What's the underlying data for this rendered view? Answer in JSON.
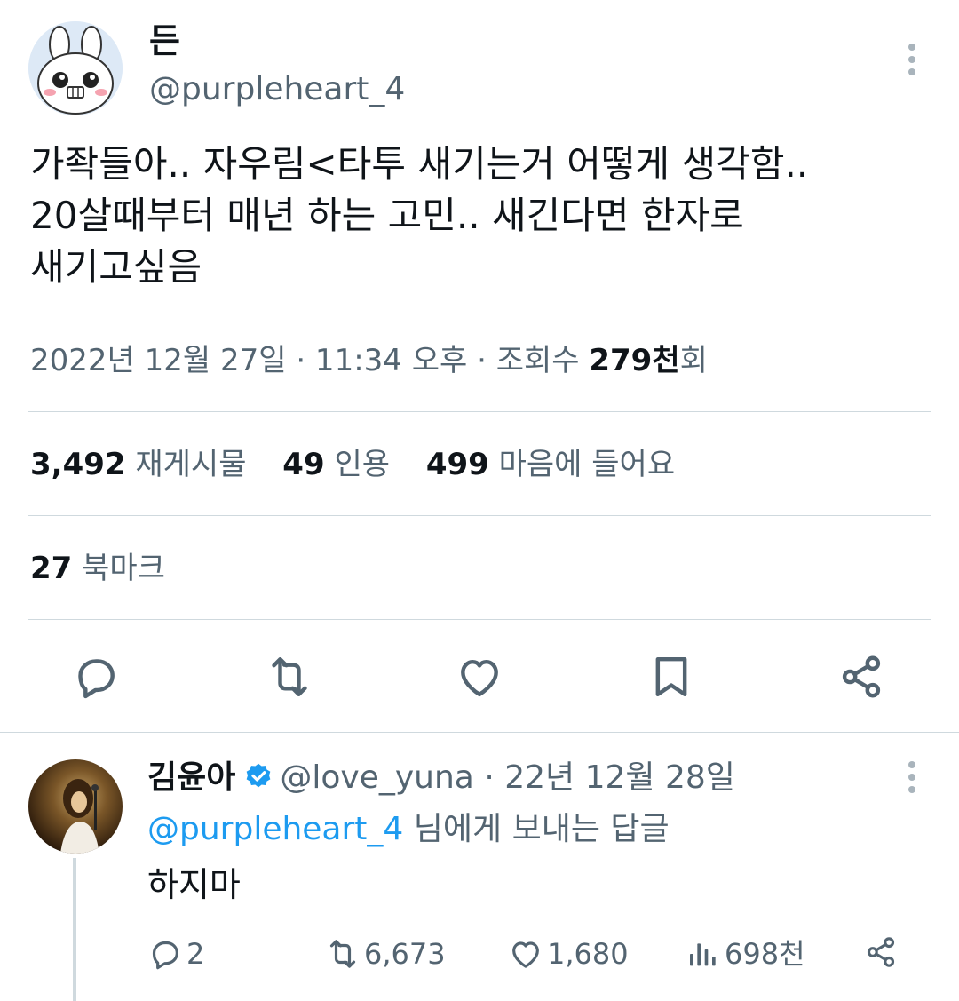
{
  "author": {
    "display_name": "든",
    "handle": "@purpleheart_4"
  },
  "tweet": {
    "text": "가좍들아.. 자우림<타투 새기는거 어떻게 생각함..\n20살때부터 매년 하는 고민.. 새긴다면 한자로\n새기고싶음",
    "timestamp": "2022년 12월 27일 · 11:34 오후 · 조회수 ",
    "views_count": "279천",
    "views_suffix": "회"
  },
  "stats": {
    "reposts_count": "3,492",
    "reposts_label": "재게시물",
    "quotes_count": "49",
    "quotes_label": "인용",
    "likes_count": "499",
    "likes_label": "마음에 들어요",
    "bookmarks_count": "27",
    "bookmarks_label": "북마크"
  },
  "actions": [
    "reply-icon",
    "repost-icon",
    "heart-icon",
    "bookmark-icon",
    "share-icon"
  ],
  "reply": {
    "display_name": "김윤아",
    "handle": "@love_yuna",
    "date": "· 22년 12월 28일",
    "reply_to_mention": "@purpleheart_4",
    "reply_to_suffix": " 님에게 보내는 답글",
    "text": "하지마",
    "replies": "2",
    "reposts": "6,673",
    "likes": "1,680",
    "views": "698천"
  },
  "colors": {
    "text": "#0f1419",
    "secondary": "#536471",
    "accent": "#1d9bf0",
    "divider": "#cfd9de"
  }
}
